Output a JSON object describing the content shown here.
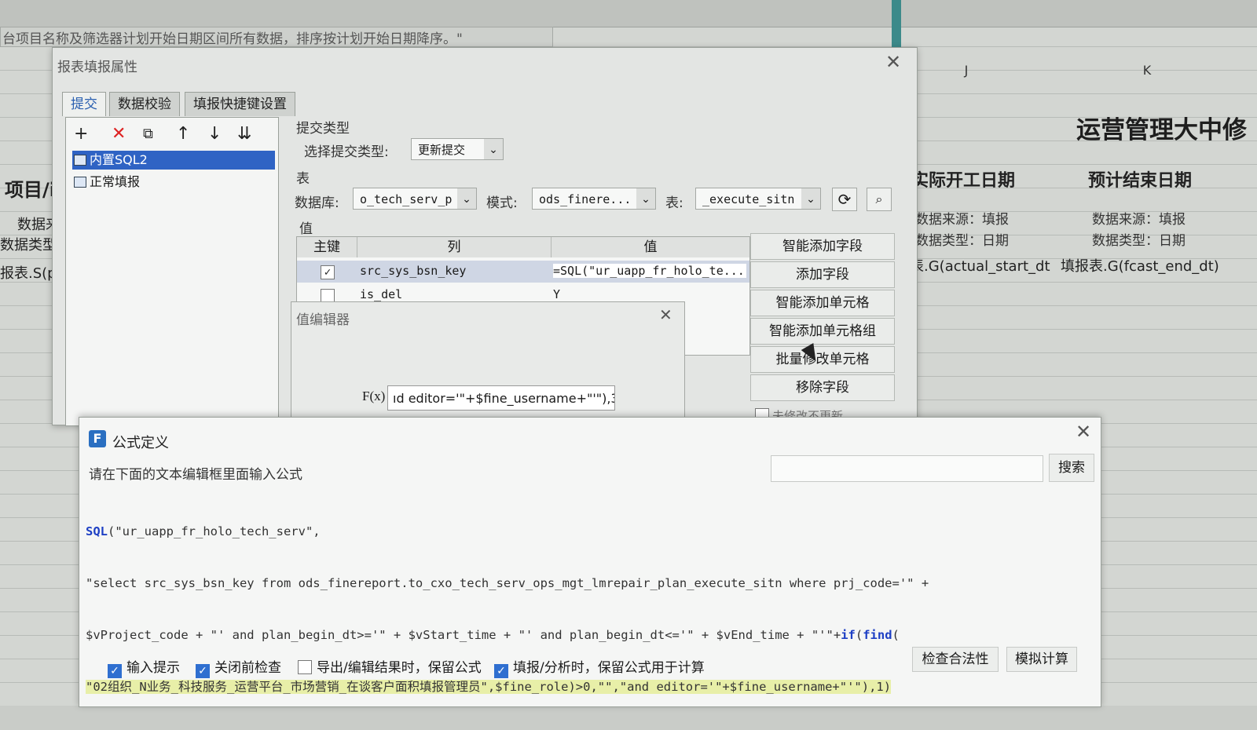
{
  "background": {
    "description_text": "台项目名称及筛选器计划开始日期区间所有数据，排序按计划开始日期降序。\"",
    "col_j": "J",
    "col_k": "K",
    "title_fragment": "运营管理大中修",
    "headers": [
      "实际开工日期",
      "预计结束日期"
    ],
    "meta_source_label": "数据来源：填报",
    "meta_type_label": "数据类型：日期",
    "formula_left": "表.G(actual_start_dt",
    "formula_right": "填报表.G(fcast_end_dt)",
    "left_fragments": [
      "项目/i",
      "数据来",
      "数据类型：",
      "报表.S(pr"
    ]
  },
  "report_dialog": {
    "title": "报表填报属性",
    "tabs": [
      "提交",
      "数据校验",
      "填报快捷键设置"
    ],
    "tree": [
      "内置SQL2",
      "正常填报"
    ],
    "submit_type_group": "提交类型",
    "submit_type_label": "选择提交类型:",
    "submit_type_value": "更新提交",
    "table_group": "表",
    "db_label": "数据库:",
    "db_value": "o_tech_serv_p",
    "schema_label": "模式:",
    "schema_value": "ods_finere...",
    "table_label": "表:",
    "table_value": "_execute_sitn",
    "value_group": "值",
    "columns": [
      "主键",
      "列",
      "值"
    ],
    "rows": [
      {
        "key": true,
        "col": "src_sys_bsn_key",
        "val": "=SQL(\"ur_uapp_fr_holo_te..."
      },
      {
        "key": false,
        "col": "is_del",
        "val": "Y"
      }
    ],
    "side_buttons": [
      "智能添加字段",
      "添加字段",
      "智能添加单元格",
      "智能添加单元格组",
      "批量修改单元格",
      "移除字段"
    ],
    "partial_option": "未修改不更新"
  },
  "value_editor": {
    "title": "值编辑器",
    "fx": "F(x)",
    "fx_value": "ıd editor='\"+$fine_username+\"'\"),3)"
  },
  "formula_dialog": {
    "title": "公式定义",
    "instruction": "请在下面的文本编辑框里面输入公式",
    "search_button": "搜索",
    "code_line1_kw": "SQL",
    "code_line1_rest": "(\"ur_uapp_fr_holo_tech_serv\",",
    "code_line2": "\"select src_sys_bsn_key from ods_finereport.to_cxo_tech_serv_ops_mgt_lmrepair_plan_execute_sitn where prj_code='\" +",
    "code_line3_a": "$vProject_code + \"' and plan_begin_dt>='\" + $vStart_time + \"' and plan_begin_dt<='\" + $vEnd_time + \"'\"+",
    "code_line3_kw1": "if",
    "code_line3_p": "(",
    "code_line3_kw2": "find",
    "code_line3_end": "(",
    "code_line4": "\"02组织_N业务_科技服务_运营平台_市场营销_在谈客户面积填报管理员\",$fine_role)>0,\"\",\"and editor='\"+$fine_username+\"'\"),1)",
    "options": [
      {
        "label": "输入提示",
        "checked": true
      },
      {
        "label": "关闭前检查",
        "checked": true
      },
      {
        "label": "导出/编辑结果时，保留公式",
        "checked": false
      },
      {
        "label": "填报/分析时，保留公式用于计算",
        "checked": true
      }
    ],
    "check_button": "检查合法性",
    "simulate_button": "模拟计算"
  }
}
